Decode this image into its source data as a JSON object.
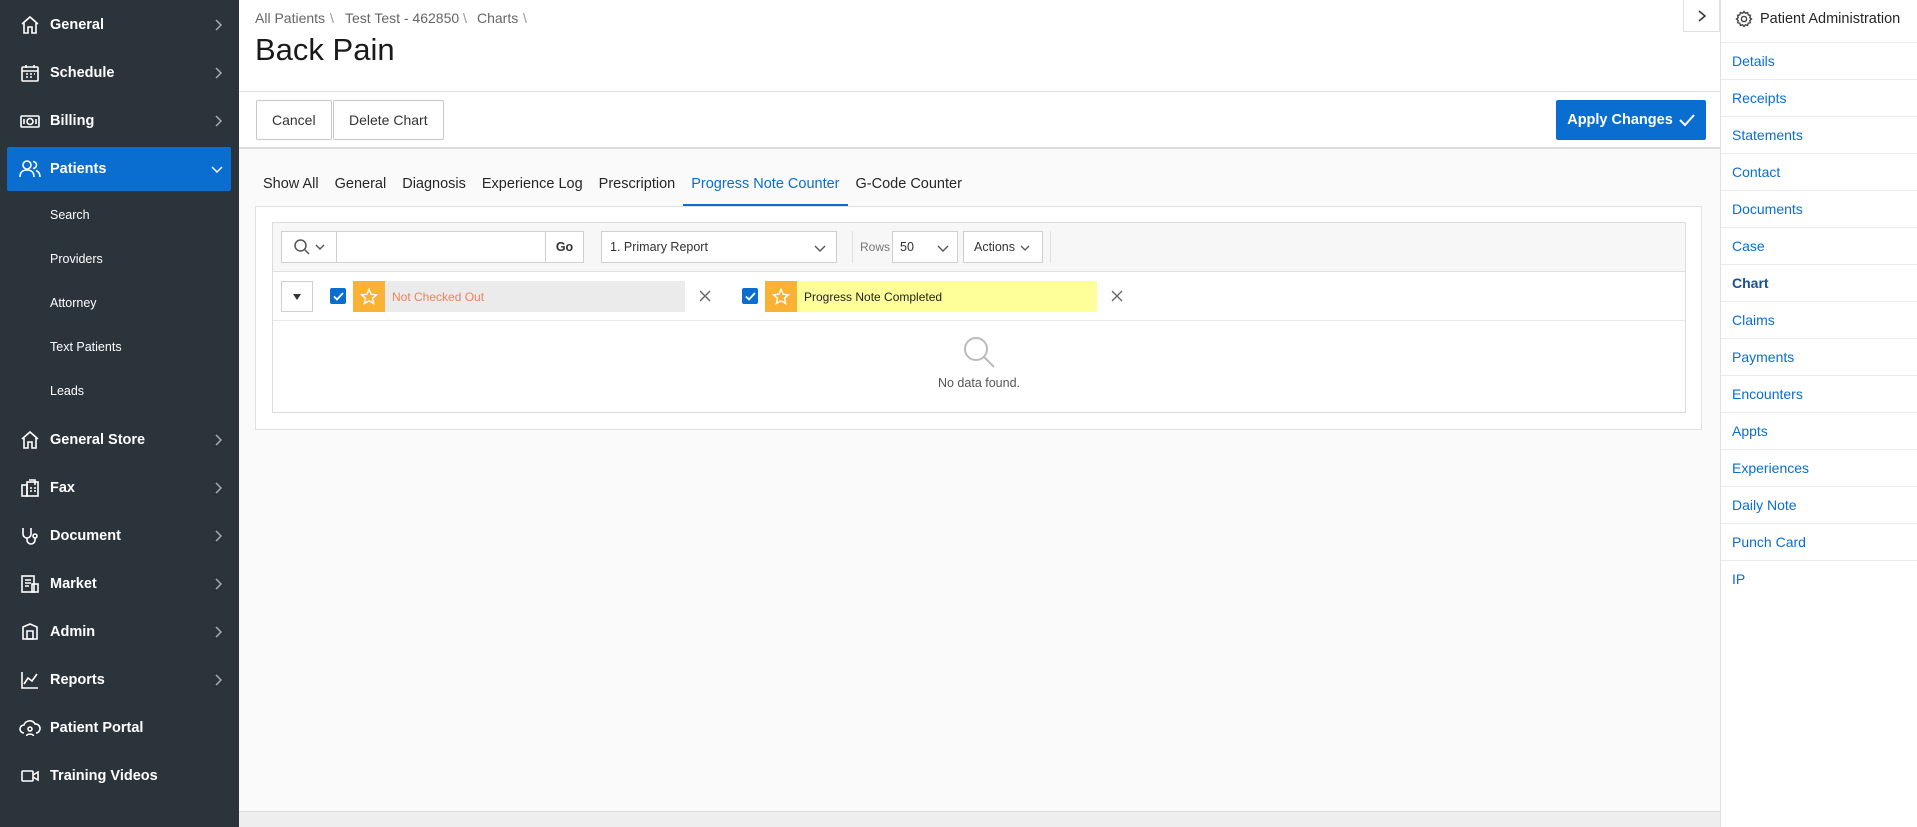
{
  "nav": {
    "items": [
      {
        "label": "General",
        "icon": "home-icon"
      },
      {
        "label": "Schedule",
        "icon": "calendar-icon"
      },
      {
        "label": "Billing",
        "icon": "money-icon"
      },
      {
        "label": "Patients",
        "icon": "users-icon"
      },
      {
        "label": "General Store",
        "icon": "store-icon"
      },
      {
        "label": "Fax",
        "icon": "fax-icon"
      },
      {
        "label": "Document",
        "icon": "stethoscope-icon"
      },
      {
        "label": "Market",
        "icon": "market-icon"
      },
      {
        "label": "Admin",
        "icon": "admin-icon"
      },
      {
        "label": "Reports",
        "icon": "chart-line-icon"
      },
      {
        "label": "Patient Portal",
        "icon": "cloud-user-icon"
      },
      {
        "label": "Training Videos",
        "icon": "video-icon"
      }
    ],
    "patients_sub": [
      "Search",
      "Providers",
      "Attorney",
      "Text Patients",
      "Leads"
    ]
  },
  "breadcrumb": [
    "All Patients",
    "Test Test - 462850",
    "Charts"
  ],
  "page_title": "Back Pain",
  "toolbar": {
    "cancel": "Cancel",
    "delete": "Delete Chart",
    "apply": "Apply Changes"
  },
  "tabs": [
    "Show All",
    "General",
    "Diagnosis",
    "Experience Log",
    "Prescription",
    "Progress Note Counter",
    "G-Code Counter"
  ],
  "active_tab": "Progress Note Counter",
  "report": {
    "go": "Go",
    "report_select": "1. Primary Report",
    "rows_label": "Rows",
    "rows_value": "50",
    "actions": "Actions",
    "filters": [
      "Not Checked Out",
      "Progress Note Completed"
    ],
    "empty_message": "No data found."
  },
  "right_panel": {
    "title": "Patient Administration",
    "items": [
      "Details",
      "Receipts",
      "Statements",
      "Contact",
      "Documents",
      "Case",
      "Chart",
      "Claims",
      "Payments",
      "Encounters",
      "Appts",
      "Experiences",
      "Daily Note",
      "Punch Card",
      "IP"
    ],
    "current": "Chart"
  },
  "colors": {
    "nav_bg": "#2b333b",
    "accent": "#0a6ed1",
    "star": "#f9b233",
    "chip_grey": "#ebebeb",
    "chip_yellow": "#ffff99",
    "chip_orange_text": "#f0805a"
  }
}
